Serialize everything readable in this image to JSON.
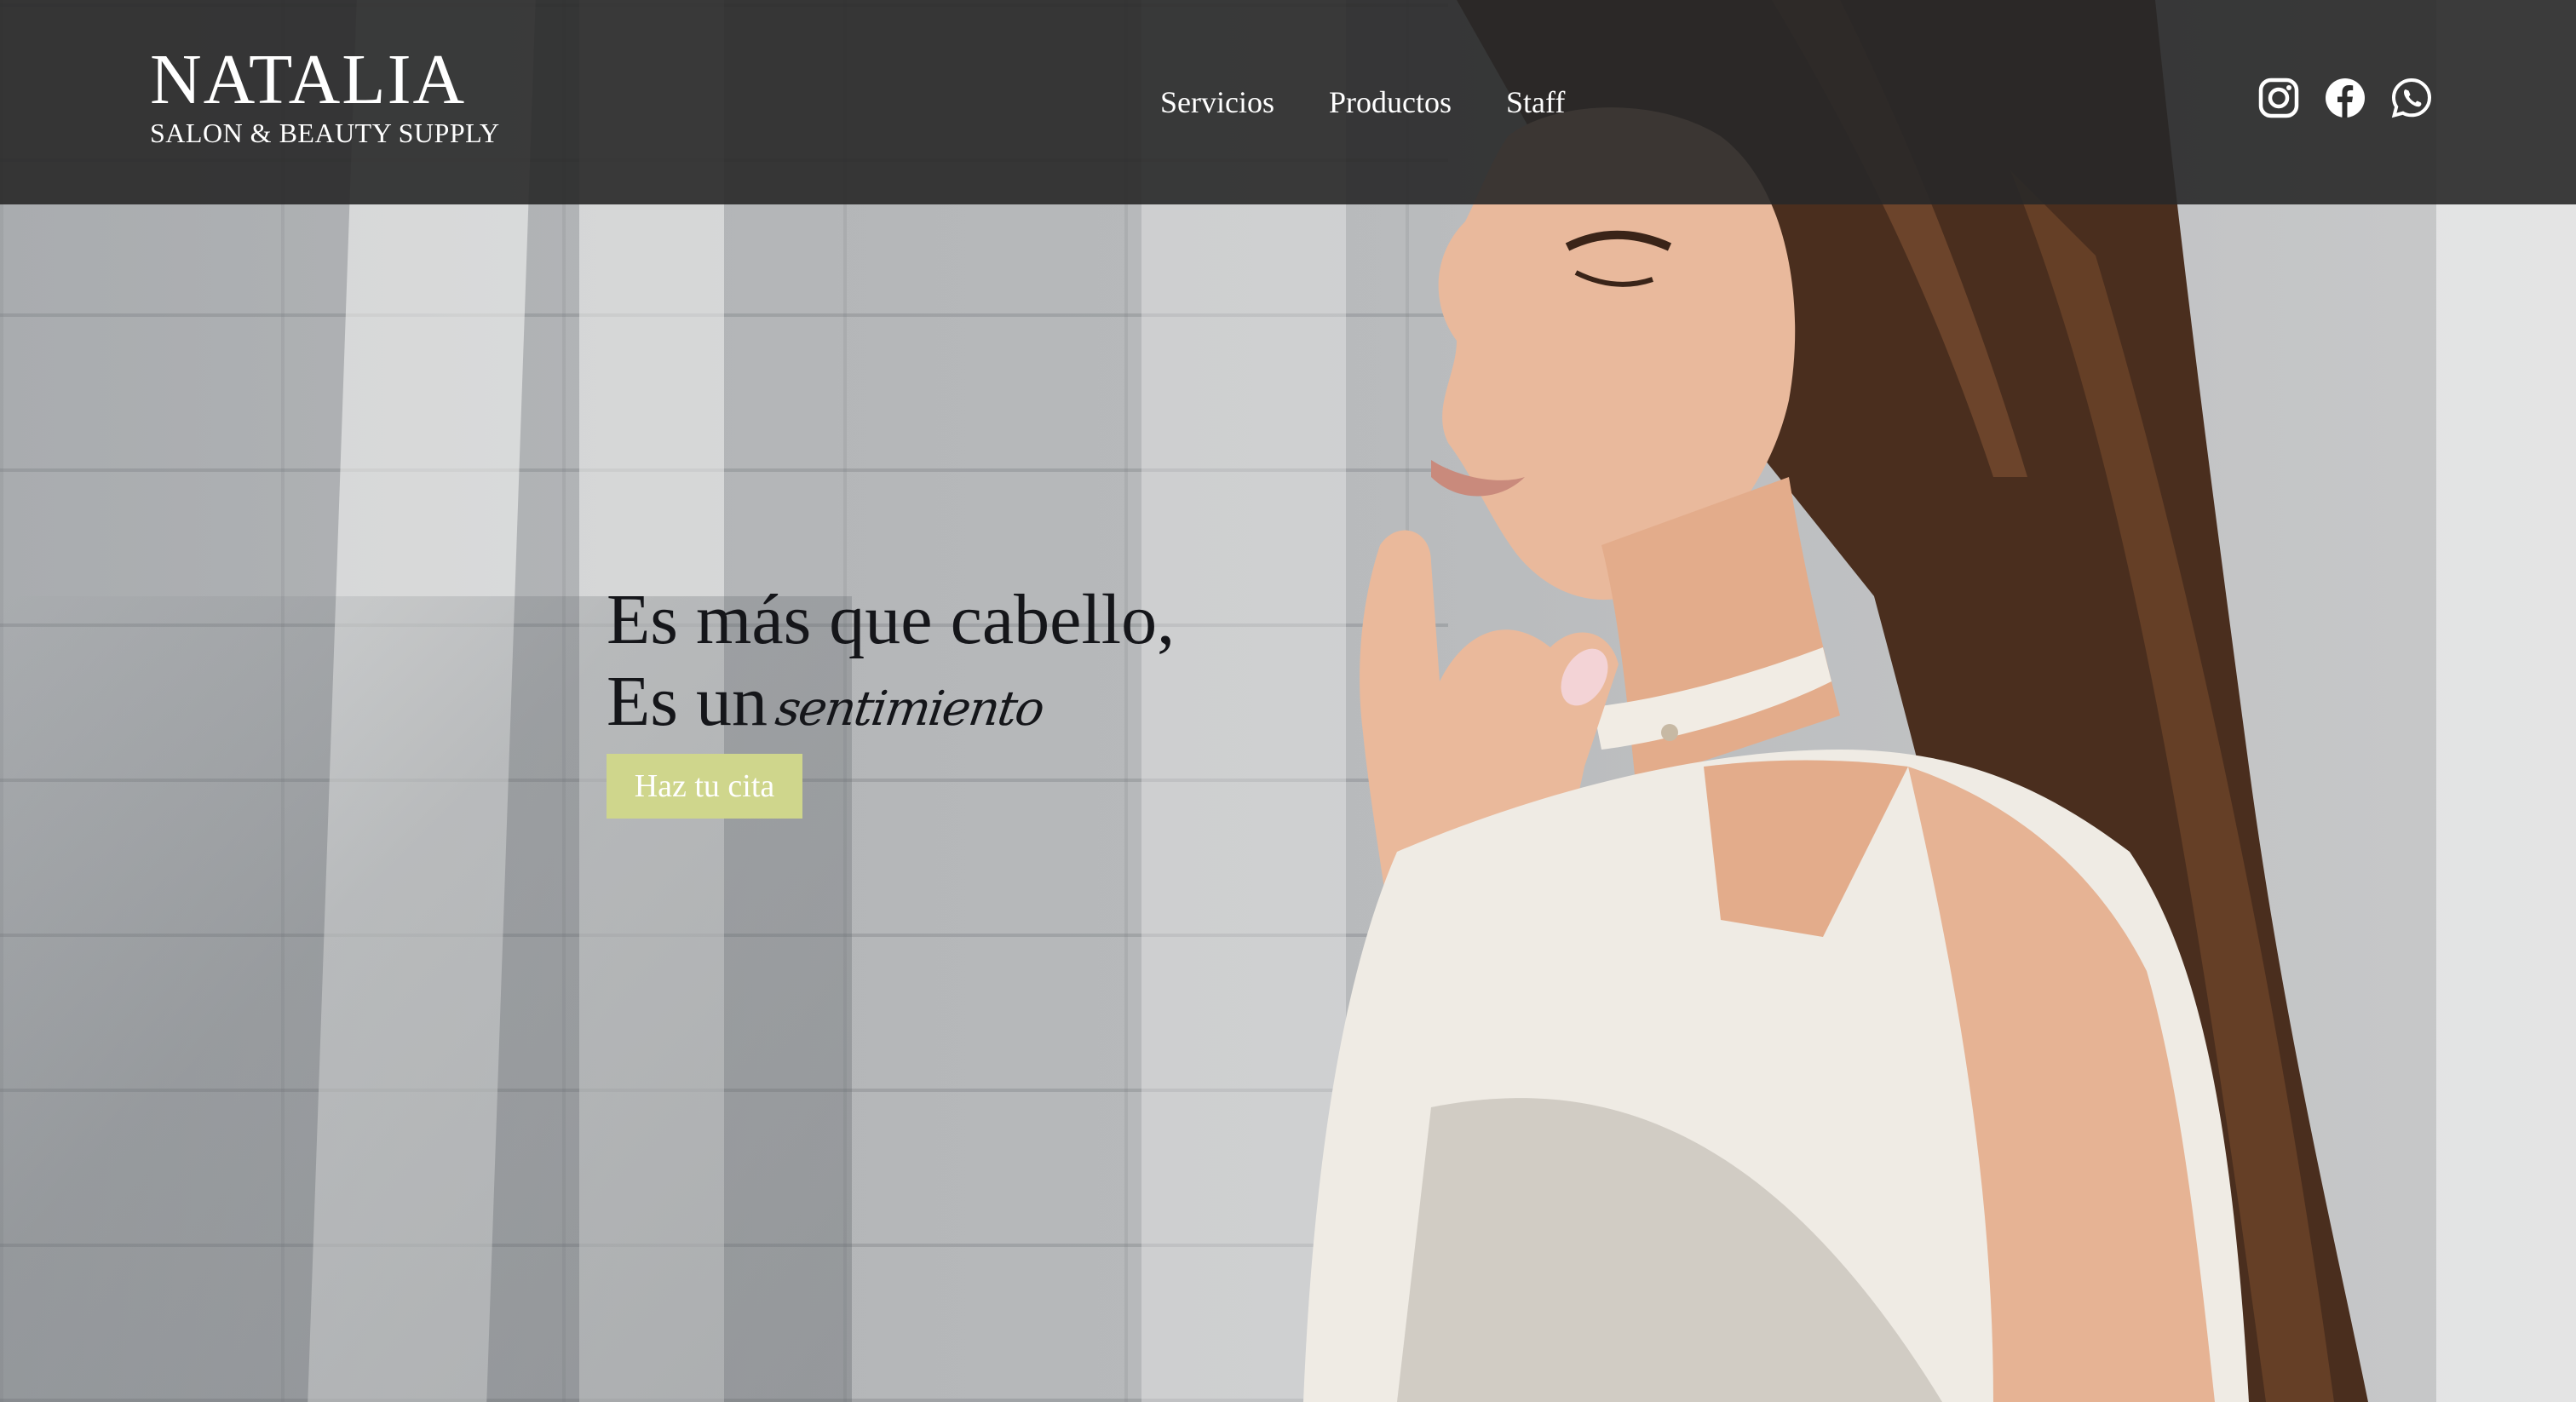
{
  "brand": {
    "name": "NATALIA",
    "subtitle": "SALON & BEAUTY SUPPLY"
  },
  "nav": {
    "items": [
      {
        "label": "Servicios"
      },
      {
        "label": "Productos"
      },
      {
        "label": "Staff"
      }
    ]
  },
  "social": {
    "icons": [
      "instagram-icon",
      "facebook-icon",
      "whatsapp-icon"
    ]
  },
  "hero": {
    "line1": "Es más que cabello,",
    "line2_prefix": "Es un",
    "line2_script": "sentimiento",
    "cta_label": "Haz tu cita"
  },
  "colors": {
    "navbar_bg": "#282828",
    "cta_bg": "#cfd68c",
    "headline_text": "#15161a",
    "nav_text": "#ffffff"
  }
}
